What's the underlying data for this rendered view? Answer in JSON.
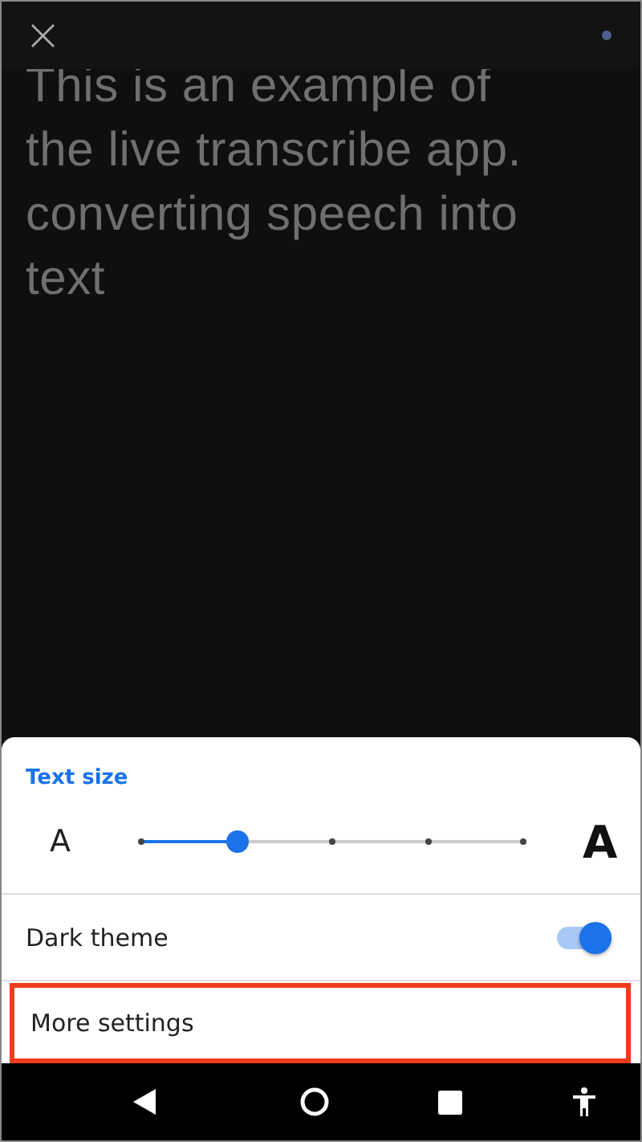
{
  "transcript": {
    "lines": [
      "This is an example of",
      "the live transcribe app.",
      "converting speech into",
      "text"
    ]
  },
  "top_bar": {
    "close_label": "×",
    "listening_dot": true
  },
  "settings_sheet": {
    "section_title": "Text size",
    "small_label": "A",
    "large_label": "A",
    "text_size": {
      "level": 0.25
    },
    "items": [
      {
        "kind": "toggle",
        "label": "Dark theme",
        "on": true
      },
      {
        "kind": "link",
        "label": "More settings",
        "highlighted": true
      }
    ]
  }
}
